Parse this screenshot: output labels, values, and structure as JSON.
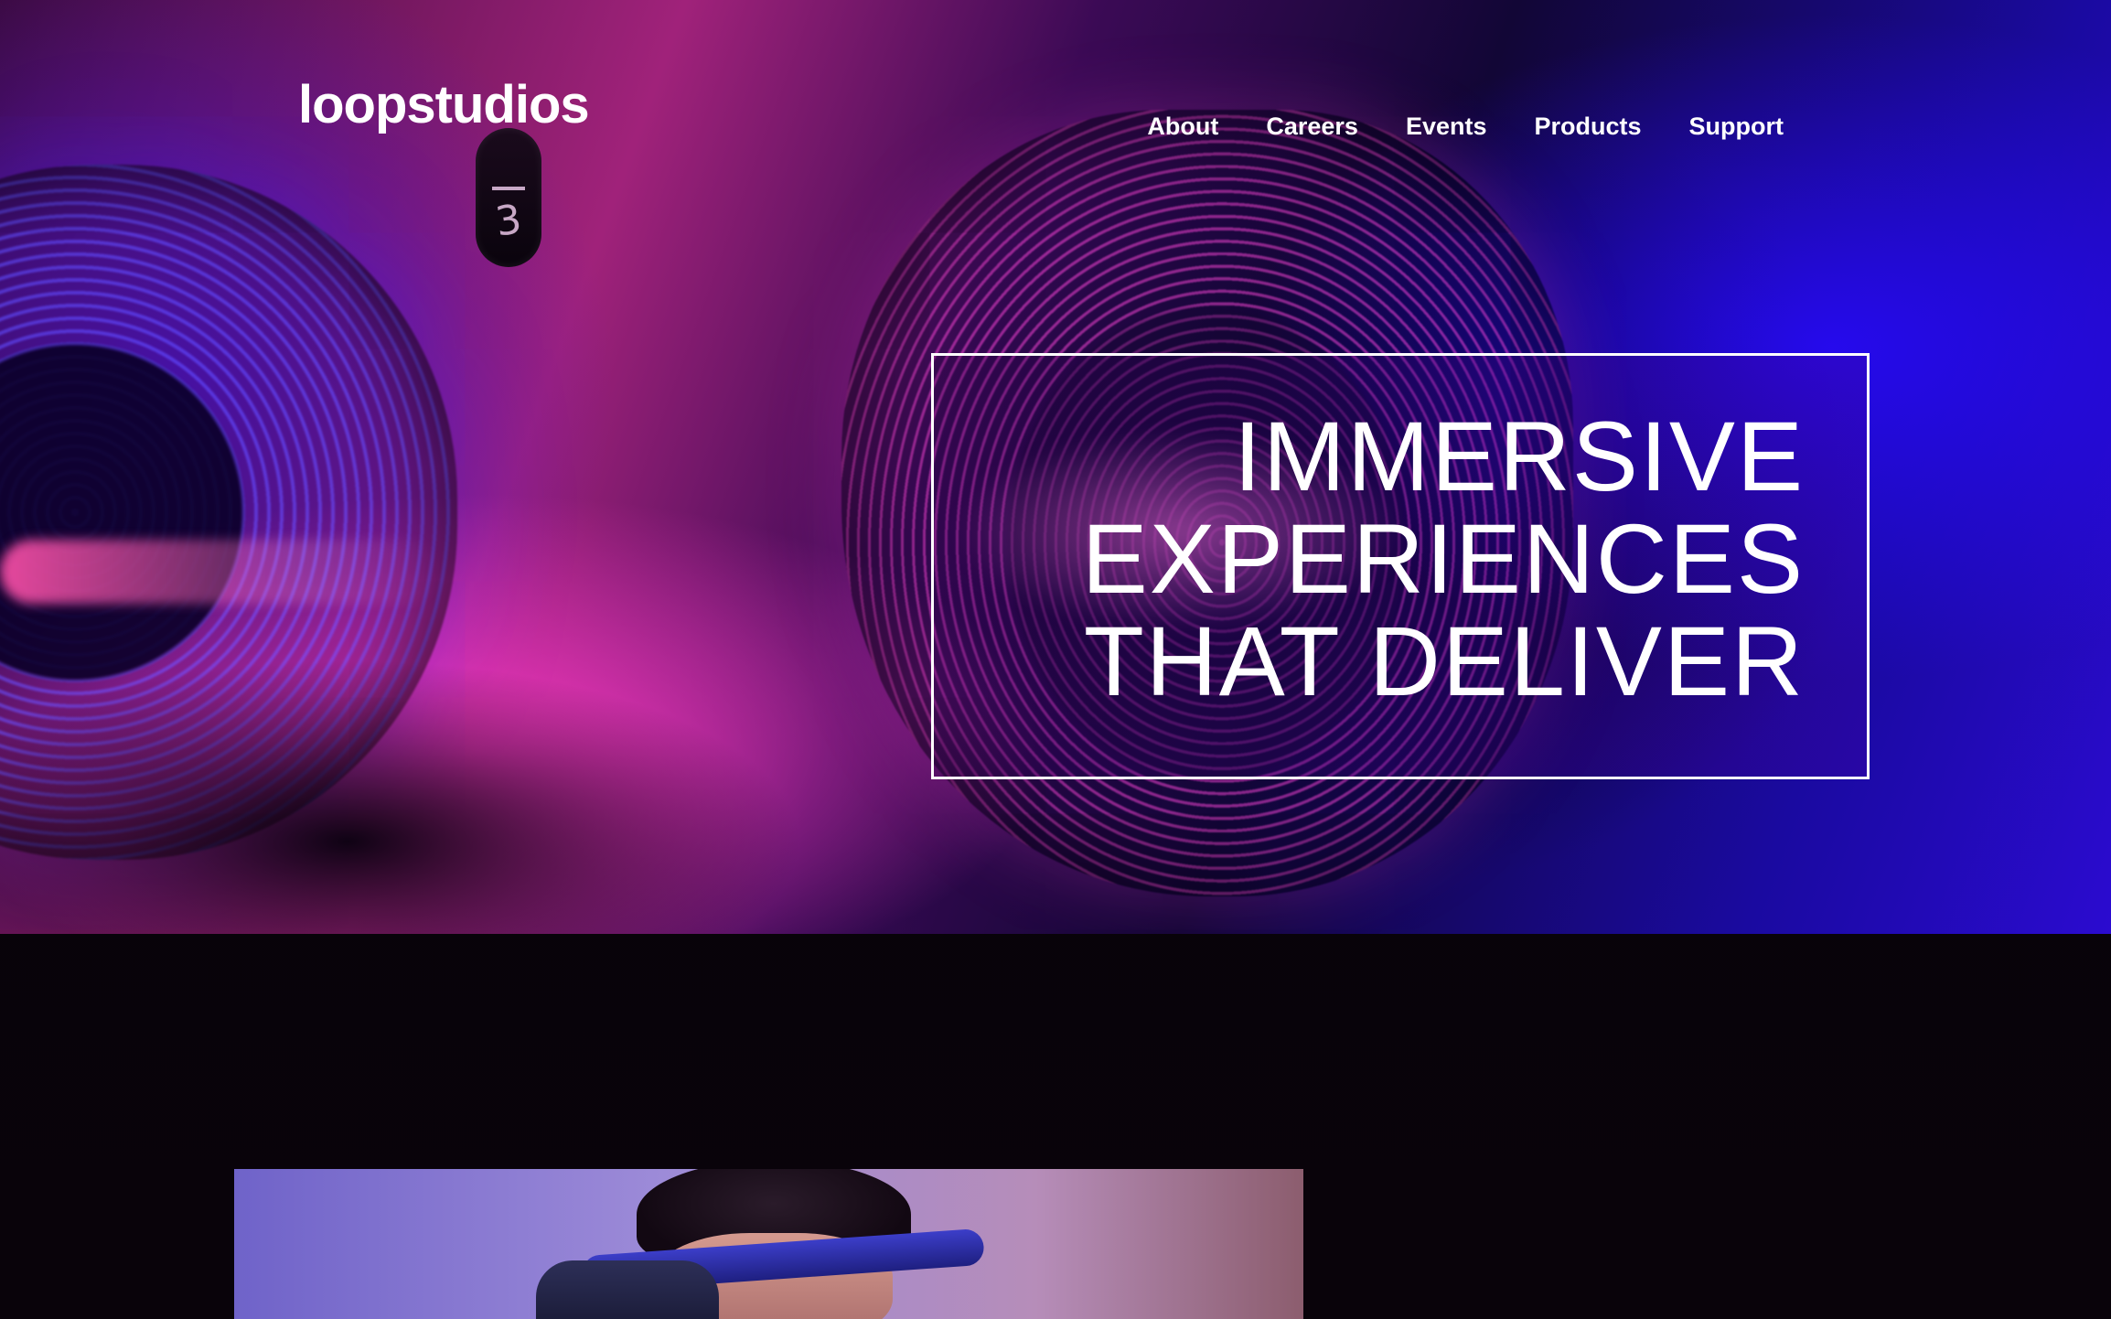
{
  "header": {
    "logo": "loopstudios",
    "nav": [
      {
        "label": "About"
      },
      {
        "label": "Careers"
      },
      {
        "label": "Events"
      },
      {
        "label": "Products"
      },
      {
        "label": "Support"
      }
    ]
  },
  "hero": {
    "lens_number": "3",
    "title_lines": [
      "IMMERSIVE",
      "EXPERIENCES",
      "THAT DELIVER"
    ]
  },
  "colors": {
    "text": "#ffffff",
    "background": "#07030a",
    "hero_pink": "#ff3cc8",
    "hero_blue": "#2b0bd0"
  }
}
